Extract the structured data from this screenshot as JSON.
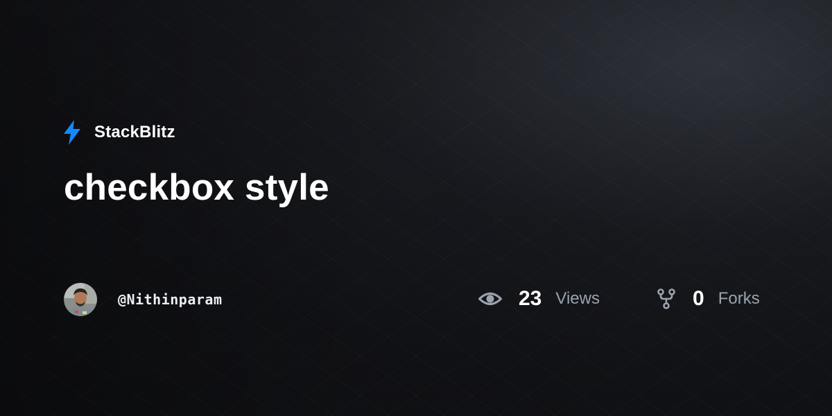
{
  "brand": {
    "name": "StackBlitz",
    "icon": "lightning-bolt-icon",
    "accent_color": "#1389fd"
  },
  "project": {
    "title": "checkbox style"
  },
  "author": {
    "username": "@Nithinparam",
    "avatar": "avatar"
  },
  "stats": {
    "views": {
      "icon": "eye-icon",
      "count": "23",
      "label": "Views"
    },
    "forks": {
      "icon": "fork-icon",
      "count": "0",
      "label": "Forks"
    }
  },
  "colors": {
    "background": "#121317",
    "text_primary": "#ffffff",
    "text_secondary": "#9aa3ae"
  }
}
